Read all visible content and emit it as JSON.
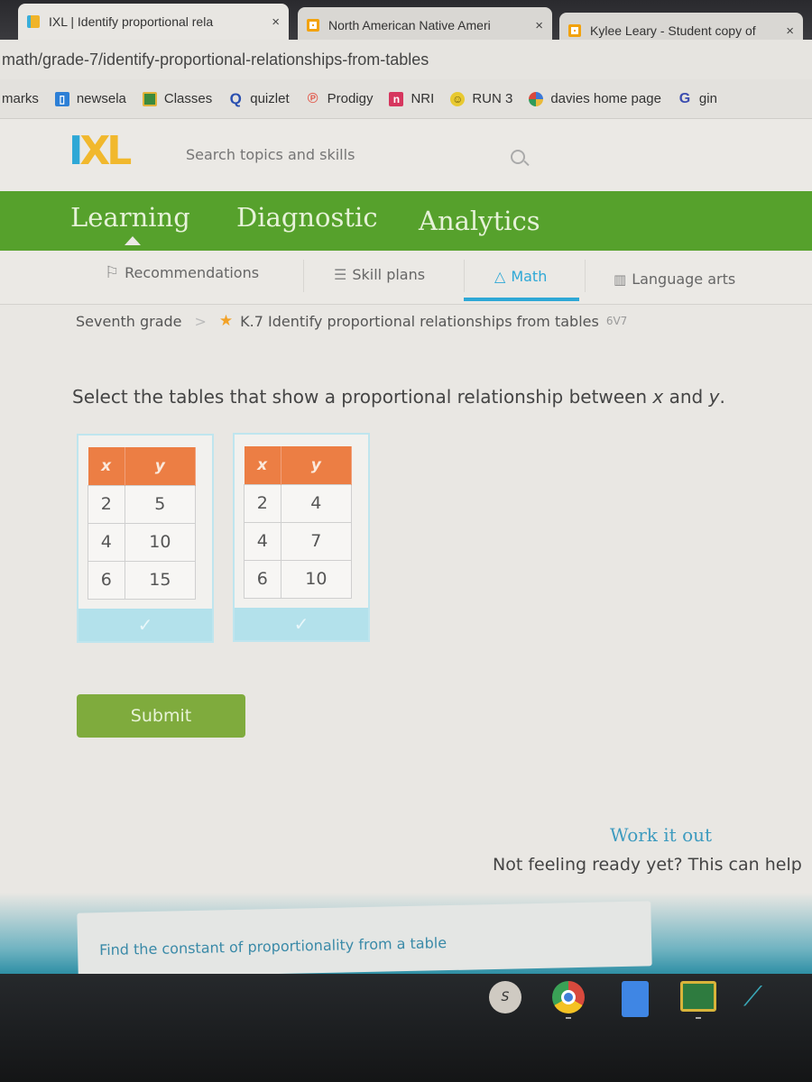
{
  "browser": {
    "tabs": [
      {
        "title": "IXL | Identify proportional rela",
        "favicon": "ixl-favicon",
        "active": true
      },
      {
        "title": "North American Native Ameri",
        "favicon": "slides-favicon",
        "active": false
      },
      {
        "title": "Kylee Leary - Student copy of",
        "favicon": "slides-favicon",
        "active": false
      }
    ],
    "close_glyph": "×",
    "url": "math/grade-7/identify-proportional-relationships-from-tables",
    "bookmarks": [
      {
        "label": "marks",
        "icon": ""
      },
      {
        "label": "newsela",
        "icon": "newsela-icon"
      },
      {
        "label": "Classes",
        "icon": "classroom-icon"
      },
      {
        "label": "quizlet",
        "icon": "quizlet-icon"
      },
      {
        "label": "Prodigy",
        "icon": "prodigy-icon"
      },
      {
        "label": "NRI",
        "icon": "nri-icon"
      },
      {
        "label": "RUN 3",
        "icon": "smiley-icon"
      },
      {
        "label": "davies home page",
        "icon": "sites-icon"
      },
      {
        "label": "gin",
        "icon": "google-icon"
      }
    ]
  },
  "ixl": {
    "logo": {
      "i": "I",
      "xl": "XL"
    },
    "search_placeholder": "Search topics and skills",
    "main_nav": [
      {
        "label": "Learning",
        "active": true
      },
      {
        "label": "Diagnostic",
        "active": false
      },
      {
        "label": "Analytics",
        "active": false
      }
    ],
    "subject_tabs": [
      {
        "label": "Recommendations",
        "icon": "recommendations-icon",
        "active": false
      },
      {
        "label": "Skill plans",
        "icon": "skill-plans-icon",
        "active": false
      },
      {
        "label": "Math",
        "icon": "math-pyramid-icon",
        "active": true
      },
      {
        "label": "Language arts",
        "icon": "language-arts-icon",
        "active": false
      }
    ],
    "breadcrumb": {
      "grade": "Seventh grade",
      "separator": ">",
      "skill": "K.7 Identify proportional relationships from tables",
      "code": "6V7"
    },
    "question": {
      "prefix": "Select the tables that show a proportional relationship between ",
      "var1": "x",
      "middle": " and ",
      "var2": "y",
      "suffix": "."
    },
    "tables": [
      {
        "headers": [
          "x",
          "y"
        ],
        "rows": [
          [
            "2",
            "5"
          ],
          [
            "4",
            "10"
          ],
          [
            "6",
            "15"
          ]
        ],
        "select_glyph": "✓"
      },
      {
        "headers": [
          "x",
          "y"
        ],
        "rows": [
          [
            "2",
            "4"
          ],
          [
            "4",
            "7"
          ],
          [
            "6",
            "10"
          ]
        ],
        "select_glyph": "✓"
      }
    ],
    "submit_label": "Submit",
    "work_it_out": {
      "title": "Work it out",
      "subtitle": "Not feeling ready yet? This can help"
    },
    "related_skill": "Find the constant of proportionality from a table"
  },
  "shelf": {
    "apps": [
      "user-avatar-icon",
      "chrome-icon",
      "google-docs-icon",
      "google-classroom-icon",
      "butterfly-app-icon"
    ]
  },
  "colors": {
    "ixl_green": "#56a12c",
    "table_header_orange": "#ec7e44",
    "accent_blue": "#2ea8d6",
    "submit_green": "#7fab3d"
  }
}
